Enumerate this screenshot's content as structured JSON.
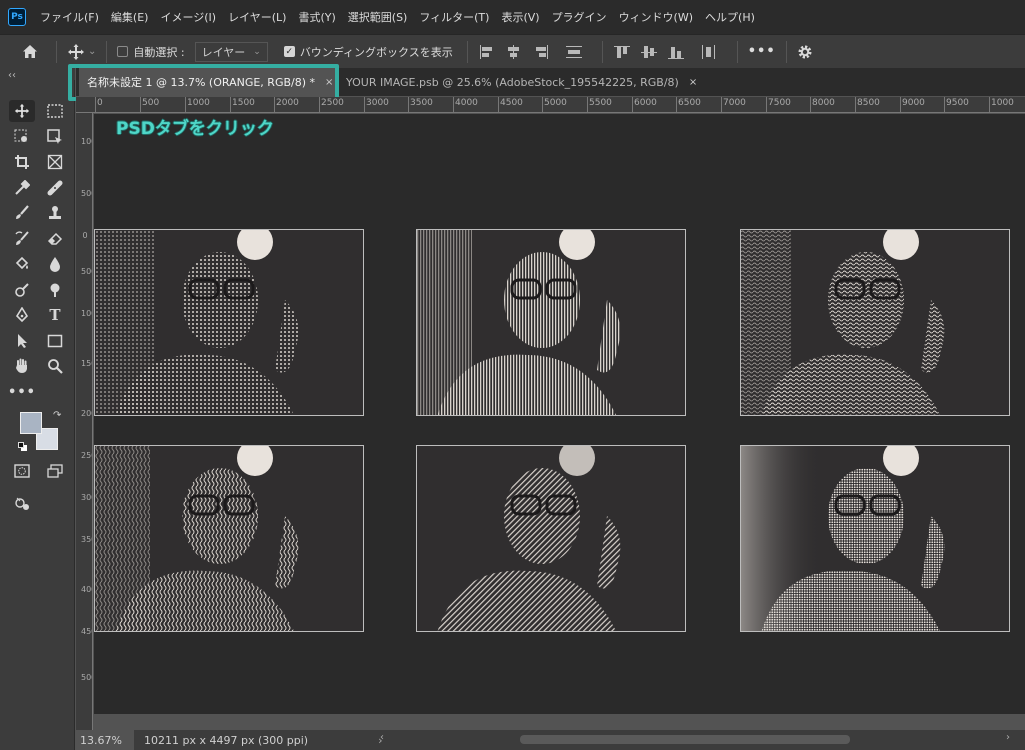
{
  "app": {
    "logo_text": "Ps"
  },
  "menu": [
    "ファイル(F)",
    "編集(E)",
    "イメージ(I)",
    "レイヤー(L)",
    "書式(Y)",
    "選択範囲(S)",
    "フィルター(T)",
    "表示(V)",
    "プラグイン",
    "ウィンドウ(W)",
    "ヘルプ(H)"
  ],
  "options": {
    "auto_select_label": "自動選択 :",
    "auto_select_checked": false,
    "layer_select_value": "レイヤー",
    "bounding_box_label": "バウンディングボックスを表示",
    "bounding_box_checked": true,
    "more_label": "•••"
  },
  "tabs": {
    "active": {
      "label": "名称未設定 1 @ 13.7% (ORANGE, RGB/8) *",
      "close": "×"
    },
    "inactive": {
      "label": "YOUR IMAGE.psb @ 25.6% (AdobeStock_195542225, RGB/8)",
      "close": "×"
    }
  },
  "annotation": {
    "text": "PSDタブをクリック",
    "color": "#4fd6c8",
    "box_color": "#35aea2"
  },
  "ruler": {
    "h_labels": [
      "0",
      "500",
      "1000",
      "1500",
      "2000",
      "2500",
      "3000",
      "3500",
      "4000",
      "4500",
      "5000",
      "5500",
      "6000",
      "6500",
      "7000",
      "7500",
      "8000",
      "8500",
      "9000",
      "9500",
      "1000"
    ],
    "v_labels": [
      "1000",
      "500",
      "0",
      "500",
      "1000",
      "1500",
      "2000",
      "2500",
      "3000",
      "3500",
      "4000",
      "4500",
      "5000"
    ]
  },
  "collapse_label": "‹‹",
  "status": {
    "zoom": "13.67%",
    "doc_info": "10211 px x 4497 px (300 ppi)",
    "arrow": "›"
  },
  "colors": {
    "foreground": "#a9b4c3",
    "background": "#d8dde5",
    "highlight": "#35aea2"
  },
  "photos": [
    "halftone-dots",
    "halftone-vertical-lines",
    "halftone-wave",
    "halftone-wave-lines",
    "halftone-diagonal-lines",
    "halftone-fine-dots"
  ]
}
